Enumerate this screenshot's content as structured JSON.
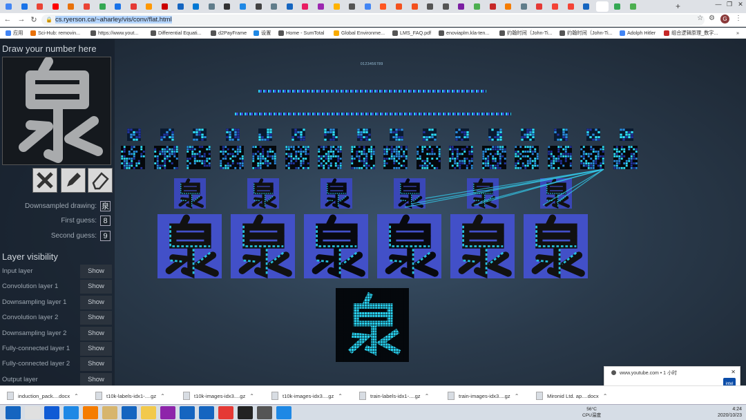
{
  "browser": {
    "url_host": "cs.ryerson.ca",
    "url_path": "/~aharley/vis/conv/flat.html",
    "window_controls": [
      "—",
      "❐",
      "✕"
    ],
    "bookmarks": [
      {
        "label": "应用"
      },
      {
        "label": "Sci-Hub: removin..."
      },
      {
        "label": "https://www.yout..."
      },
      {
        "label": "Differential Equati..."
      },
      {
        "label": "d2PayFrame"
      },
      {
        "label": "设置"
      },
      {
        "label": "Home - SumTotal"
      },
      {
        "label": "Global Environme..."
      },
      {
        "label": "LMS_FAQ.pdf"
      },
      {
        "label": "enoviaplm.kla-ten..."
      },
      {
        "label": "约翰时间（John-Ti..."
      },
      {
        "label": "约翰时间（John-Ti..."
      },
      {
        "label": "Adolph Hitler"
      },
      {
        "label": "组合逻辑原理_数字..."
      }
    ],
    "more_bookmarks": "»"
  },
  "app": {
    "draw_title": "Draw your number here",
    "drawn_char": "泉",
    "tools": [
      {
        "name": "clear",
        "icon": "x-icon"
      },
      {
        "name": "pencil",
        "icon": "pencil-icon"
      },
      {
        "name": "eraser",
        "icon": "eraser-icon"
      }
    ],
    "downsampled_label": "Downsampled drawing:",
    "downsampled_char": "泉",
    "first_guess_label": "First guess:",
    "first_guess": "8",
    "second_guess_label": "Second guess:",
    "second_guess": "9",
    "layer_visibility_title": "Layer visibility",
    "layers": [
      {
        "name": "Input layer",
        "btn": "Show"
      },
      {
        "name": "Convolution layer 1",
        "btn": "Show"
      },
      {
        "name": "Downsampling layer 1",
        "btn": "Show"
      },
      {
        "name": "Convolution layer 2",
        "btn": "Show"
      },
      {
        "name": "Downsampling layer 2",
        "btn": "Show"
      },
      {
        "name": "Fully-connected layer 1",
        "btn": "Show"
      },
      {
        "name": "Fully-connected layer 2",
        "btn": "Show"
      },
      {
        "name": "Output layer",
        "btn": "Show"
      }
    ],
    "output_digits": "0123456789",
    "input_char": "泉"
  },
  "notification": {
    "source": "www.youtube.com • 1 小时",
    "badge": "intel"
  },
  "downloads": [
    {
      "name": "induction_pack....docx"
    },
    {
      "name": "t10k-labels-idx1-....gz"
    },
    {
      "name": "t10k-images-idx3....gz"
    },
    {
      "name": "t10k-images-idx3....gz"
    },
    {
      "name": "train-labels-idx1-....gz"
    },
    {
      "name": "train-images-idx3....gz"
    },
    {
      "name": "Mironid Ltd. ap....docx"
    }
  ],
  "taskbar": {
    "temp": "56°C",
    "temp_label": "CPU温度",
    "time": "4:24",
    "date": "2020/10/23"
  },
  "colors": {
    "accent": "#28d2f0",
    "bg": "#2a3a4b"
  }
}
